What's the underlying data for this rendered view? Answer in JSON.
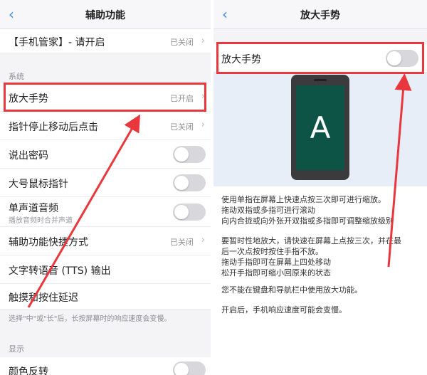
{
  "colors": {
    "accent": "#3a8ee6",
    "highlight_red": "#e8383d",
    "toggle_off": "#d8d8dc",
    "phone_screen": "#0e5446"
  },
  "left": {
    "title": "辅助功能",
    "back_icon": "chevron-left-icon",
    "top_item": {
      "label": "【手机管家】- 请开启",
      "status": "已关闭"
    },
    "section_system": "系统",
    "items": [
      {
        "label": "放大手势",
        "status": "已开启",
        "kind": "link"
      },
      {
        "label": "指针停止移动后点击",
        "status": "已关闭",
        "kind": "link"
      },
      {
        "label": "说出密码",
        "kind": "toggle",
        "on": false
      },
      {
        "label": "大号鼠标指针",
        "kind": "toggle",
        "on": false
      },
      {
        "label": "单声道音频",
        "sublabel": "播放音频时合并声道",
        "kind": "toggle",
        "on": false
      },
      {
        "label": "辅助功能快捷方式",
        "status": "已关闭",
        "kind": "link"
      },
      {
        "label": "文字转语音 (TTS) 输出",
        "kind": "link"
      },
      {
        "label": "触摸和按住延迟",
        "kind": "link"
      }
    ],
    "delay_note": "选择\"中\"或\"长\"后，长按屏幕时的响应速度会变慢。",
    "section_display": "显示",
    "display_items": [
      {
        "label": "颜色反转",
        "kind": "toggle",
        "on": false
      }
    ]
  },
  "right": {
    "title": "放大手势",
    "back_icon": "chevron-left-icon",
    "toggle_label": "放大手势",
    "toggle_on": false,
    "illustration_letter": "A",
    "paragraphs": [
      [
        "使用单指在屏幕上快速点按三次即可进行缩放。",
        "拖动双指或多指可进行滚动",
        "向内合拢或向外张开双指或多指即可调整缩放级别"
      ],
      [
        "要暂时性地放大，请快速在屏幕上点按三次，并在最",
        "后一次点按时按住手指不放。",
        "拖动手指即可在屏幕上四处移动",
        "松开手指即可缩小回原来的状态"
      ],
      [
        "您不能在键盘和导航栏中使用放大功能。"
      ],
      [
        "开启后，手机响应速度可能会变慢。"
      ]
    ]
  }
}
